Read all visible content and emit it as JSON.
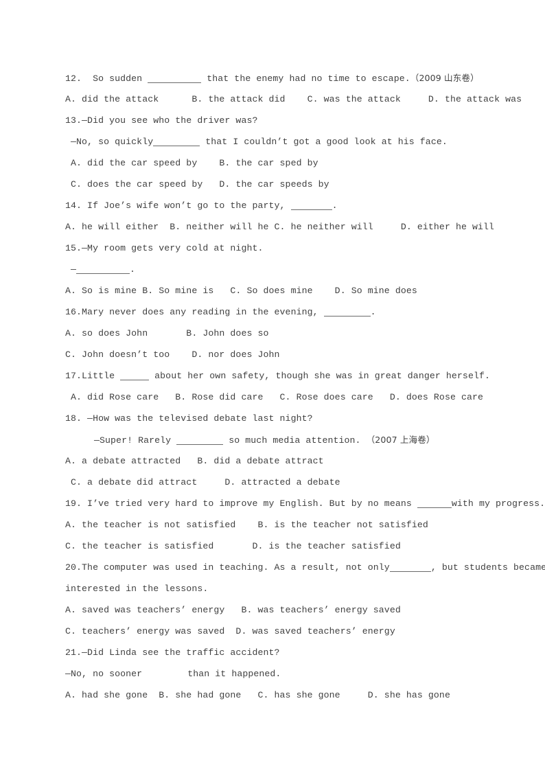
{
  "document": {
    "type": "english-grammar-worksheet",
    "page_background": "#ffffff",
    "text_color": "#3f3f3f"
  },
  "questions": [
    {
      "number": "12.",
      "stem_pre": "12.  So sudden ",
      "stem_post": " that the enemy had no time to escape.",
      "source_open": "（2009 ",
      "source_cn": "山东卷",
      "source_close": "）",
      "options_line": "A. did the attack      B. the attack did    C. was the attack     D. the attack was"
    },
    {
      "number": "13.",
      "stem": "13.—Did you see who the driver was?",
      "reply_pre": " —No, so quickly",
      "reply_post": " that I couldn’t got a good look at his face.",
      "options_line_1": " A. did the car speed by    B. the car sped by",
      "options_line_2": " C. does the car speed by   D. the car speeds by"
    },
    {
      "number": "14.",
      "stem_pre": "14. If Joe’s wife won’t go to the party, ",
      "stem_post": ".",
      "options_line": "A. he will either  B. neither will he C. he neither will     D. either he will"
    },
    {
      "number": "15.",
      "stem": "15.—My room gets very cold at night.",
      "reply_pre": " —",
      "reply_post": ".",
      "options_line": "A. So is mine B. So mine is   C. So does mine    D. So mine does"
    },
    {
      "number": "16.",
      "stem_pre": "16.Mary never does any reading in the evening, ",
      "stem_post": ".",
      "options_line_1": "A. so does John       B. John does so",
      "options_line_2": "C. John doesn’t too    D. nor does John"
    },
    {
      "number": "17.",
      "stem_pre": "17.Little ",
      "stem_post": " about her own safety, though she was in great danger herself.",
      "options_line": " A. did Rose care   B. Rose did care   C. Rose does care   D. does Rose care"
    },
    {
      "number": "18.",
      "stem": "18. —How was the televised debate last night?",
      "reply_pre": "—Super! Rarely ",
      "reply_post": " so much media attention. ",
      "source_open": "（2007 ",
      "source_cn": "上海卷",
      "source_close": "）",
      "options_line_1": "A. a debate attracted   B. did a debate attract",
      "options_line_2": " C. a debate did attract     D. attracted a debate"
    },
    {
      "number": "19.",
      "stem_pre": "19. I’ve tried very hard to improve my English. But by no means ",
      "stem_post": "with my progress.",
      "options_line_1": "A. the teacher is not satisfied    B. is the teacher not satisfied",
      "options_line_2": "C. the teacher is satisfied       D. is the teacher satisfied"
    },
    {
      "number": "20.",
      "stem_pre": "20.The computer was used in teaching. As a result, not only",
      "stem_post": ", but students became more",
      "stem_line_2": "interested in the lessons.",
      "options_line_1": "A. saved was teachers’ energy   B. was teachers’ energy saved",
      "options_line_2": "C. teachers’ energy was saved  D. was saved teachers’ energy"
    },
    {
      "number": "21.",
      "stem": "21.—Did Linda see the traffic accident?",
      "reply_pre": "—No, no sooner",
      "reply_post": "than it happened.",
      "options_line": "A. had she gone  B. she had gone   C. has she gone     D. she has gone"
    }
  ]
}
